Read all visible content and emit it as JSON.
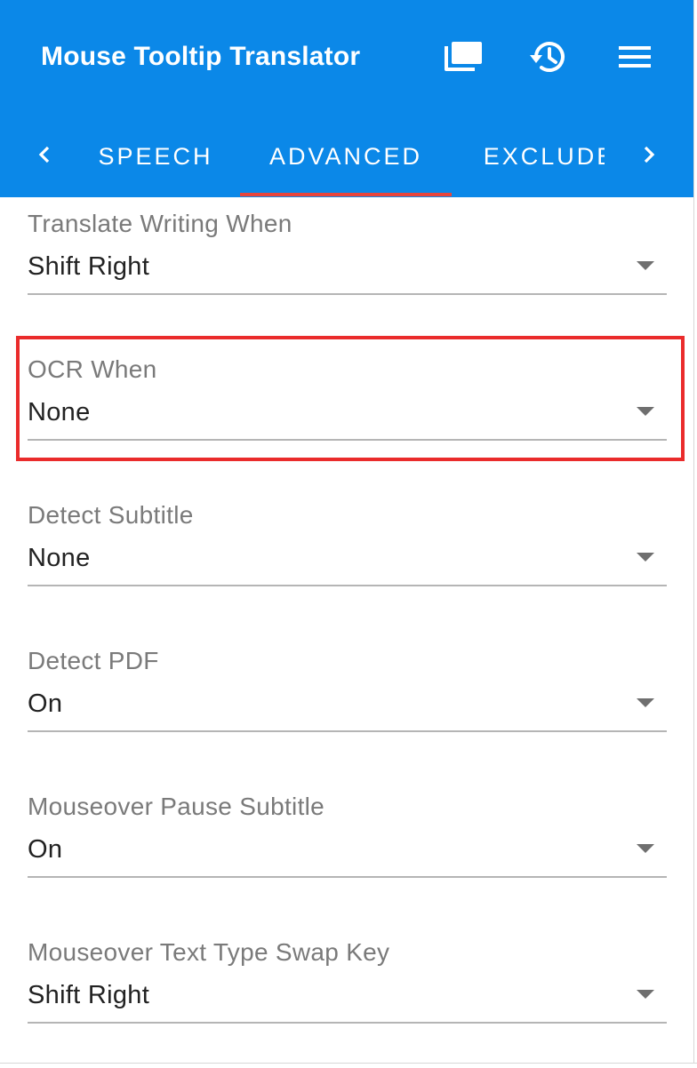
{
  "app": {
    "title": "Mouse Tooltip Translator"
  },
  "toolbar": {
    "actions": [
      {
        "icon": "window-stack-icon"
      },
      {
        "icon": "history-icon"
      },
      {
        "icon": "hamburger-menu-icon"
      }
    ]
  },
  "tabs": {
    "items": [
      "SPEECH",
      "ADVANCED",
      "EXCLUDE"
    ],
    "active": "ADVANCED",
    "left_arrow_icon": "chevron-left-icon",
    "right_arrow_icon": "chevron-right-icon"
  },
  "fields": [
    {
      "label": "Translate Writing When",
      "value": "Shift Right"
    },
    {
      "label": "OCR When",
      "value": "None"
    },
    {
      "label": "Detect Subtitle",
      "value": "None"
    },
    {
      "label": "Detect PDF",
      "value": "On"
    },
    {
      "label": "Mouseover Pause Subtitle",
      "value": "On"
    },
    {
      "label": "Mouseover Text Type Swap Key",
      "value": "Shift Right"
    }
  ],
  "highlighted_field": "OCR When",
  "colors": {
    "app_bar": "#0b88e8",
    "tab_indicator": "#e8453c",
    "highlight_box": "#ea2b2b",
    "label_text": "#7a7a7a",
    "value_text": "#222222"
  }
}
